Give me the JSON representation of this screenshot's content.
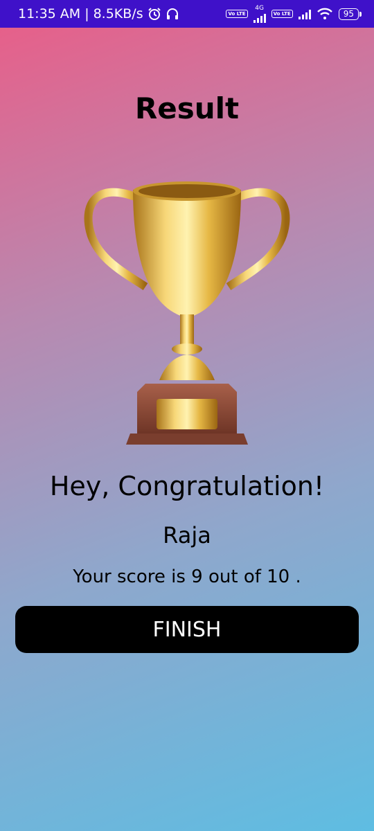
{
  "status_bar": {
    "time": "11:35 AM",
    "separator": "|",
    "speed": "8.5KB/s",
    "network_label": "4G",
    "volte_label": "Vo LTE",
    "battery": "95"
  },
  "screen": {
    "title": "Result",
    "trophy_icon": "trophy-icon",
    "congrats": "Hey, Congratulation!",
    "player_name": "Raja",
    "score_text": "Your score is 9 out of  10 .",
    "finish_label": "FINISH"
  },
  "colors": {
    "status_bar_bg": "#3f11c9",
    "gradient_top": "#e6608a",
    "gradient_bottom": "#5ebde2",
    "button_bg": "#000000"
  }
}
